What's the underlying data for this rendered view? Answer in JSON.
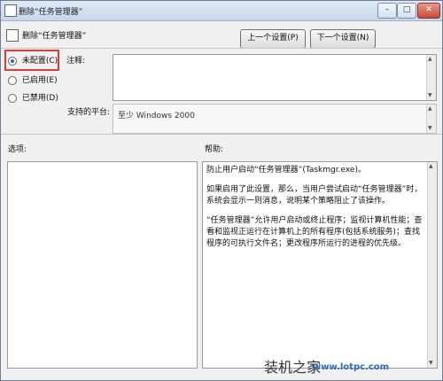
{
  "window": {
    "title": "删除“任务管理器”",
    "controls": [
      "–",
      "□",
      "✕"
    ]
  },
  "header": {
    "policy_name": "删除“任务管理器”",
    "prev_button": "上一个设置(P)",
    "next_button": "下一个设置(N)"
  },
  "state": {
    "options": [
      {
        "label": "未配置(C)",
        "selected": true
      },
      {
        "label": "已启用(E)",
        "selected": false
      },
      {
        "label": "已禁用(D)",
        "selected": false
      }
    ]
  },
  "fields": {
    "comment_label": "注释:",
    "comment_value": "",
    "platform_label": "支持的平台:",
    "platform_value": "至少 Windows 2000"
  },
  "panels": {
    "options_label": "选项:",
    "help_label": "帮助:",
    "help_text": [
      "防止用户启动“任务管理器”(Taskmgr.exe)。",
      "如果启用了此设置，那么，当用户尝试启动“任务管理器”时，系统会显示一则消息，说明某个策略阻止了该操作。",
      "“任务管理器”允许用户启动或终止程序；监视计算机性能；查看和监视正运行在计算机上的所有程序(包括系统服务)；查找程序的可执行文件名；更改程序所运行的进程的优先级。"
    ]
  },
  "watermark": {
    "brand": "装机之家",
    "url": "www.lotpc.com"
  },
  "icons": {
    "window": "policy-icon",
    "header": "policy-icon"
  }
}
